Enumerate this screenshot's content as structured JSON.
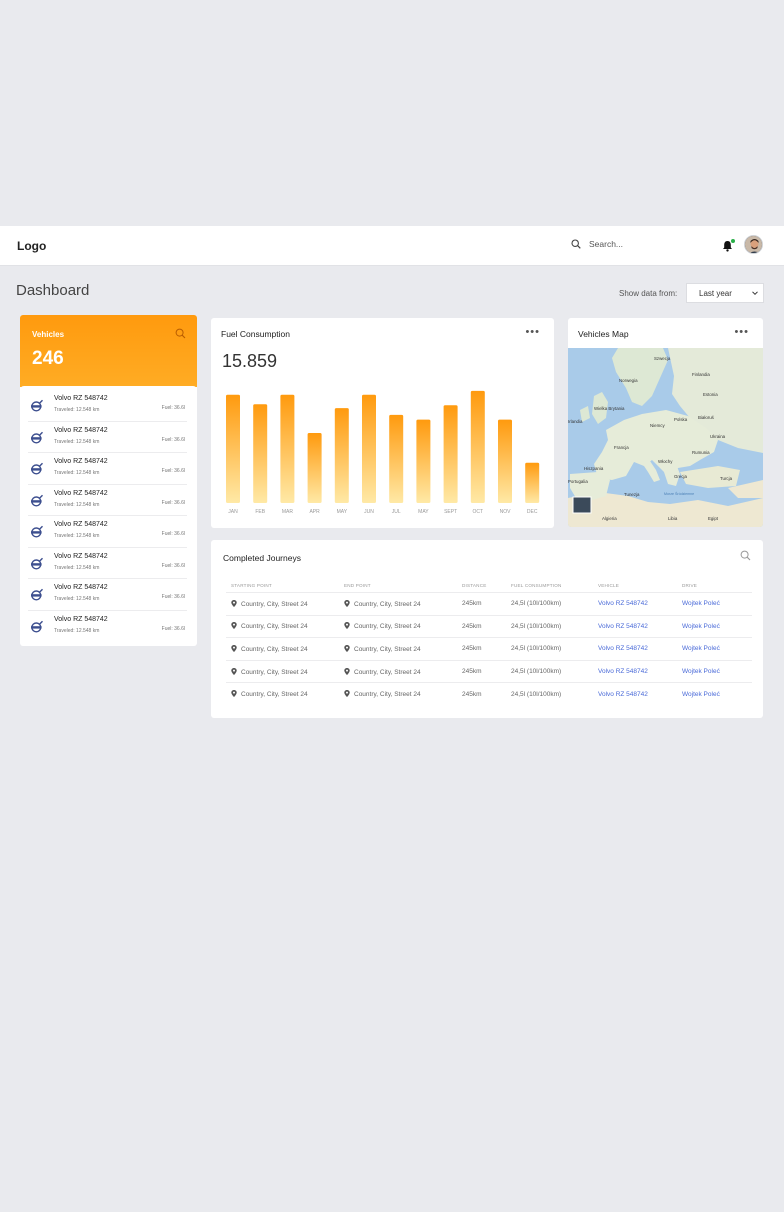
{
  "header": {
    "logo": "Logo",
    "search_placeholder": "Search..."
  },
  "page": {
    "title": "Dashboard",
    "show_data_label": "Show data from:",
    "range_selected": "Last year"
  },
  "vehicles": {
    "title": "Vehicles",
    "count": "246",
    "items": [
      {
        "name": "Volvo RZ 548742",
        "traveled": "Traveled: 12.548 km",
        "fuel": "Fuel: 36.6l"
      },
      {
        "name": "Volvo RZ 548742",
        "traveled": "Traveled: 12.548 km",
        "fuel": "Fuel: 36.6l"
      },
      {
        "name": "Volvo RZ 548742",
        "traveled": "Traveled: 12.548 km",
        "fuel": "Fuel: 36.6l"
      },
      {
        "name": "Volvo RZ 548742",
        "traveled": "Traveled: 12.548 km",
        "fuel": "Fuel: 36.6l"
      },
      {
        "name": "Volvo RZ 548742",
        "traveled": "Traveled: 12.548 km",
        "fuel": "Fuel: 36.6l"
      },
      {
        "name": "Volvo RZ 548742",
        "traveled": "Traveled: 12.548 km",
        "fuel": "Fuel: 36.6l"
      },
      {
        "name": "Volvo RZ 548742",
        "traveled": "Traveled: 12.548 km",
        "fuel": "Fuel: 36.6l"
      },
      {
        "name": "Volvo RZ 548742",
        "traveled": "Traveled: 12.548 km",
        "fuel": "Fuel: 36.6l"
      }
    ]
  },
  "fuel": {
    "title": "Fuel Consumption",
    "menu": "•••",
    "value": "15.859"
  },
  "map": {
    "title": "Vehicles Map",
    "menu": "•••",
    "labels": [
      "Szwecja",
      "Finlandia",
      "Norwegia",
      "Estonia",
      "Wielka Brytania",
      "Irlandia",
      "Polska",
      "Białoruś",
      "Niemcy",
      "Ukraina",
      "Francja",
      "Rumunia",
      "Hiszpania",
      "Włochy",
      "Portugalia",
      "Grecja",
      "Turcja",
      "Tunezja",
      "Morze Śródziemne",
      "Algieria",
      "Libia",
      "Egipt"
    ]
  },
  "journeys": {
    "title": "Completed Journeys",
    "columns": [
      "STARTING POINT",
      "END POINT",
      "DISTANCE",
      "FUEL CONSUMPTION",
      "VEHICLE",
      "DRIVE"
    ],
    "rows": [
      {
        "start": "Country, City, Street 24",
        "end": "Country, City, Street 24",
        "distance": "245km",
        "fuel": "24,5l (10l/100km)",
        "vehicle": "Volvo RZ 548742",
        "driver": "Wojtek Poleć"
      },
      {
        "start": "Country, City, Street 24",
        "end": "Country, City, Street 24",
        "distance": "245km",
        "fuel": "24,5l (10l/100km)",
        "vehicle": "Volvo RZ 548742",
        "driver": "Wojtek Poleć"
      },
      {
        "start": "Country, City, Street 24",
        "end": "Country, City, Street 24",
        "distance": "245km",
        "fuel": "24,5l (10l/100km)",
        "vehicle": "Volvo RZ 548742",
        "driver": "Wojtek Poleć"
      },
      {
        "start": "Country, City, Street 24",
        "end": "Country, City, Street 24",
        "distance": "245km",
        "fuel": "24,5l (10l/100km)",
        "vehicle": "Volvo RZ 548742",
        "driver": "Wojtek Poleć"
      },
      {
        "start": "Country, City, Street 24",
        "end": "Country, City, Street 24",
        "distance": "245km",
        "fuel": "24,5l (10l/100km)",
        "vehicle": "Volvo RZ 548742",
        "driver": "Wojtek Poleć"
      }
    ]
  },
  "colors": {
    "accent": "#ff9a0e",
    "bar_top": "#ff9a0e",
    "bar_bottom": "#ffe9a6",
    "link": "#4a6ad8",
    "background": "#e9eaee"
  },
  "icons": [
    "search-icon",
    "bell-icon",
    "avatar",
    "volvo-logo-icon",
    "more-dots-icon",
    "location-pin-icon",
    "chevron-down-icon"
  ],
  "chart_data": {
    "type": "bar",
    "categories": [
      "JAN",
      "FEB",
      "MAR",
      "APR",
      "MAY",
      "JUN",
      "JUL",
      "MAY",
      "SEPT",
      "OCT",
      "NOV",
      "DEC"
    ],
    "values": [
      113,
      103,
      113,
      73,
      99,
      113,
      92,
      87,
      102,
      117,
      87,
      42
    ],
    "ylim": [
      0,
      120
    ],
    "title": "",
    "xlabel": "",
    "ylabel": "",
    "grid": false
  }
}
